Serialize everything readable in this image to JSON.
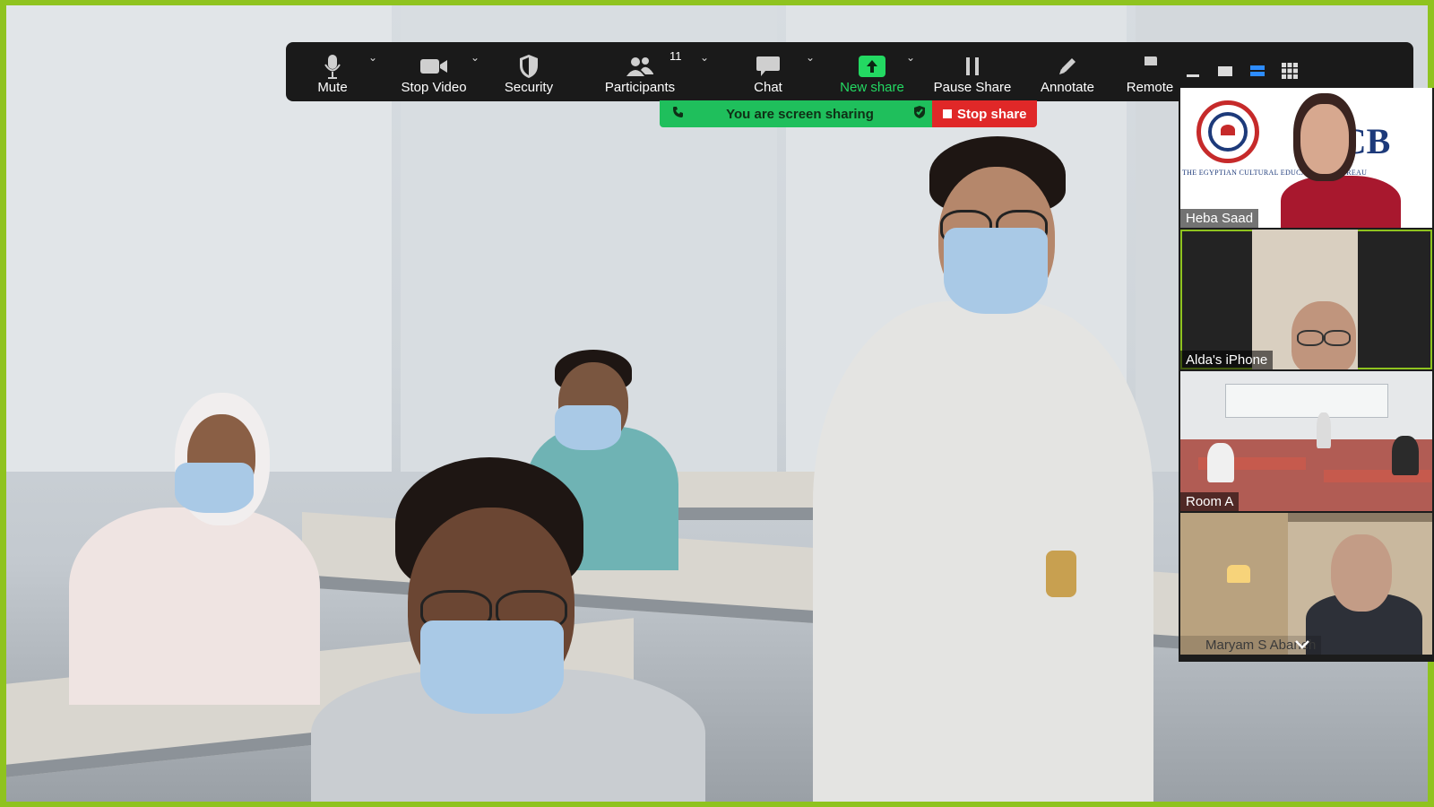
{
  "toolbar": {
    "mute_label": "Mute",
    "stop_video_label": "Stop Video",
    "security_label": "Security",
    "participants_label": "Participants",
    "participants_count": "11",
    "chat_label": "Chat",
    "new_share_label": "New share",
    "pause_share_label": "Pause Share",
    "annotate_label": "Annotate",
    "remote_label": "Remote"
  },
  "share_status": {
    "sharing_text": "You are screen sharing",
    "stop_share_label": "Stop share"
  },
  "tiles": [
    {
      "name": "Heba Saad",
      "logo_text": "ECB",
      "logo_caption": "THE EGYPTIAN CULTURAL EDUCATIONAL BUREAU"
    },
    {
      "name": "Alda's iPhone"
    },
    {
      "name": "Room A"
    },
    {
      "name": "Maryam S Abaneh"
    }
  ],
  "colors": {
    "share_border": "#8fc31f",
    "new_share_green": "#23d962",
    "stop_red": "#e02828",
    "toolbar_bg": "#1a1a1a"
  },
  "icons": [
    "microphone-icon",
    "video-camera-icon",
    "shield-icon",
    "participants-icon",
    "chat-bubble-icon",
    "share-arrow-icon",
    "pause-icon",
    "pencil-icon",
    "remote-icon"
  ]
}
